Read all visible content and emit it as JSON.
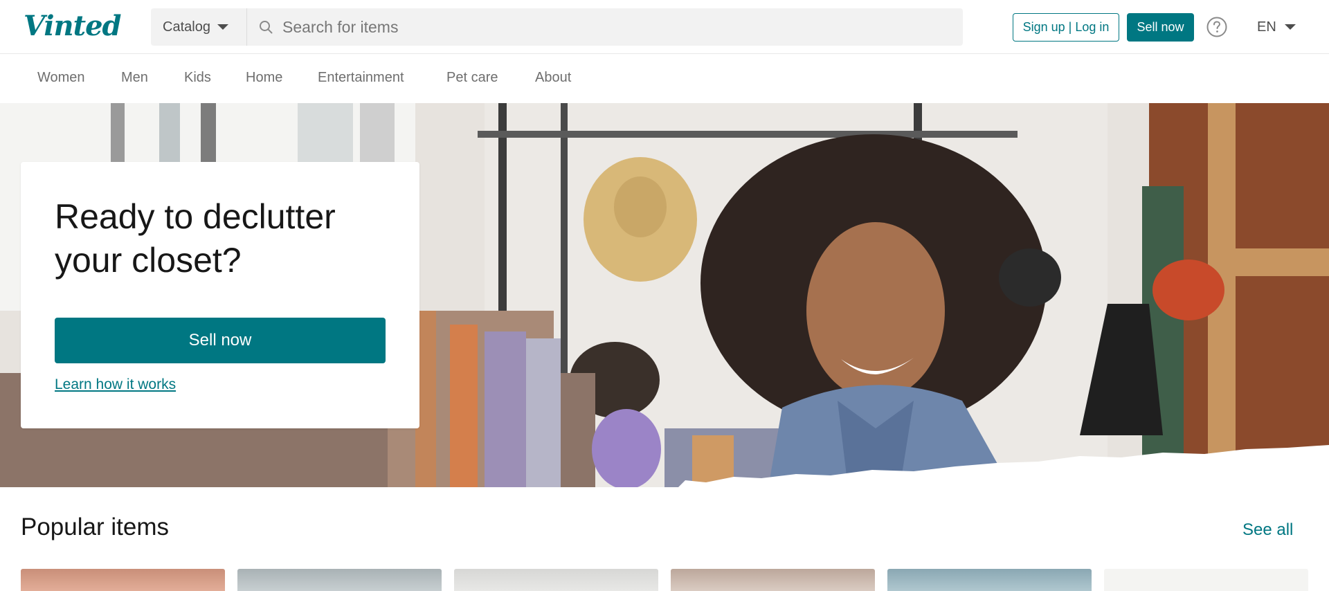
{
  "header": {
    "logo": "Vinted",
    "catalog_label": "Catalog",
    "search_placeholder": "Search for items",
    "signup_login_label": "Sign up | Log in",
    "sell_now_label": "Sell now",
    "help_icon": "question-circle-icon",
    "language": "EN"
  },
  "nav": {
    "items": [
      "Women",
      "Men",
      "Kids",
      "Home",
      "Entertainment",
      "Pet care",
      "About"
    ]
  },
  "hero": {
    "title": "Ready to declutter your closet?",
    "sell_button": "Sell now",
    "learn_link": "Learn how it works"
  },
  "popular": {
    "title": "Popular items",
    "see_all": "See all"
  },
  "colors": {
    "brand": "#007782",
    "text": "#171717",
    "muted": "#6e6e6e"
  }
}
